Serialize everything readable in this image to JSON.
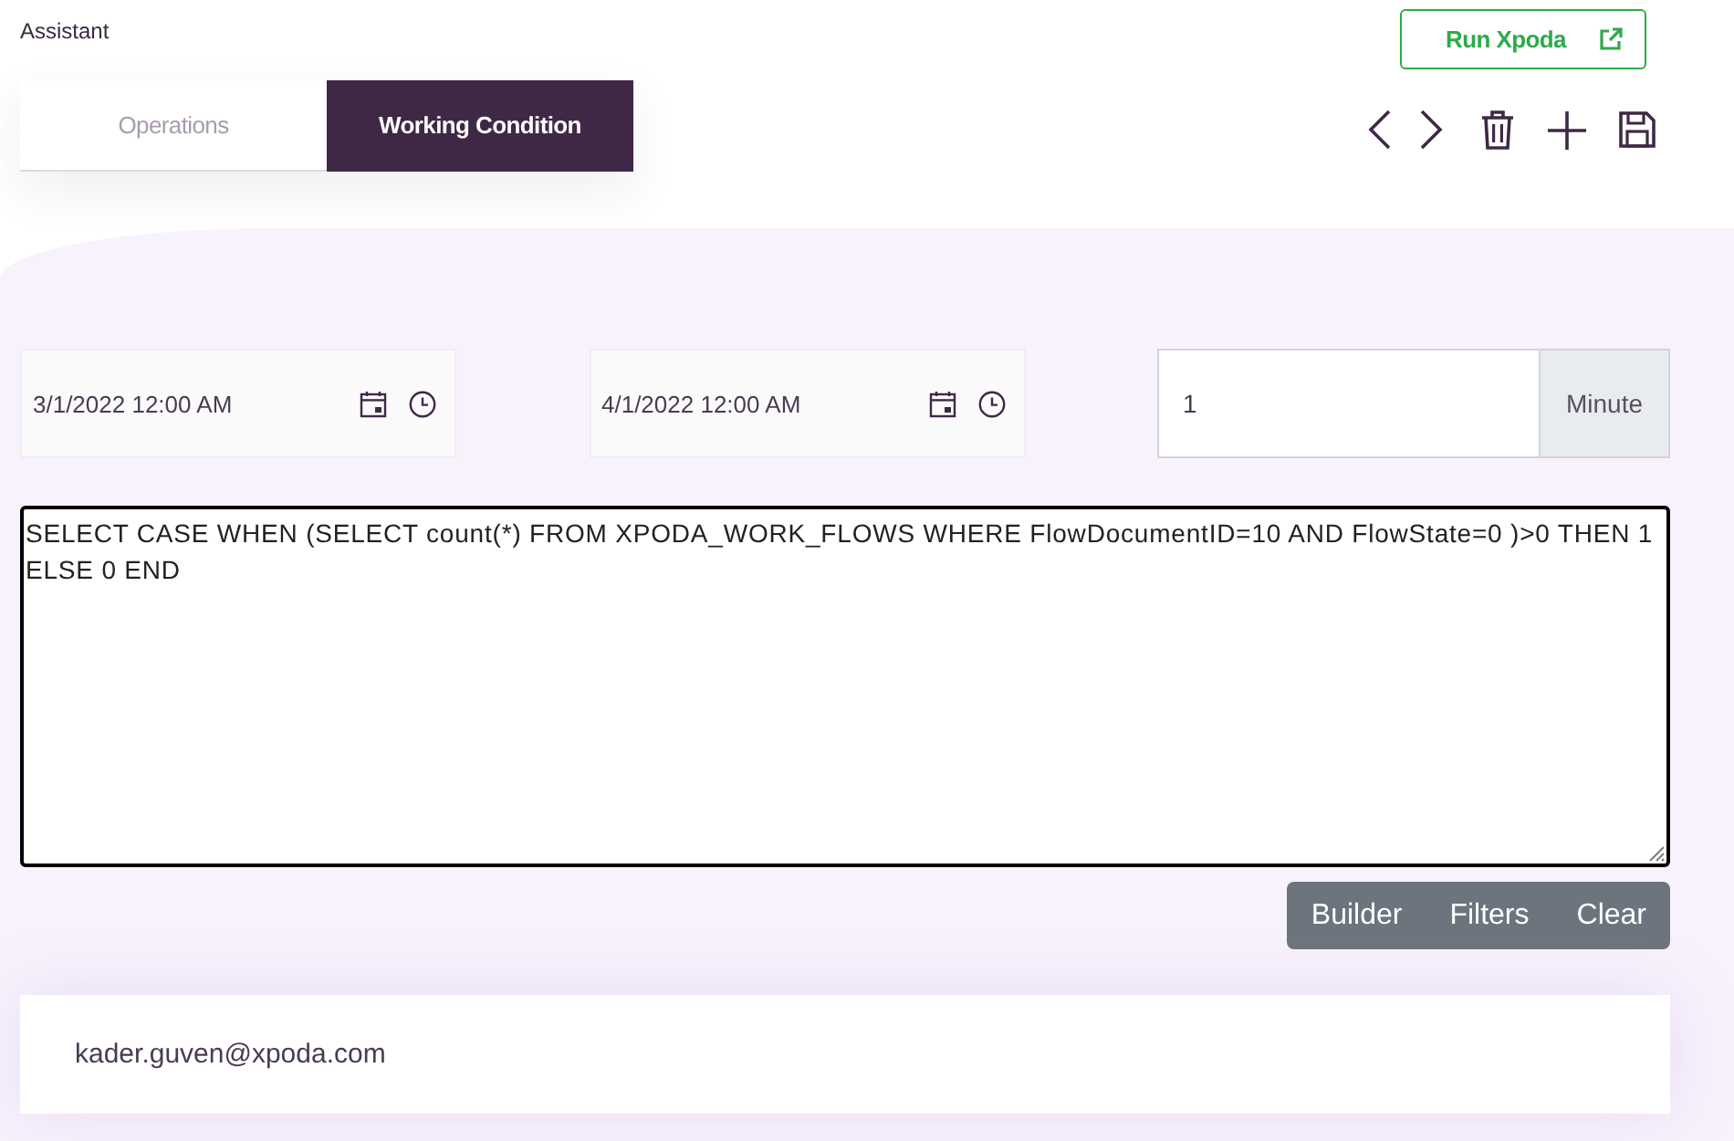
{
  "header": {
    "title": "Assistant"
  },
  "tabs": [
    {
      "label": "Operations",
      "selected": false
    },
    {
      "label": "Working Condition",
      "selected": true
    }
  ],
  "run_button": {
    "label": "Run Xpoda"
  },
  "date_range": [
    {
      "value": "3/1/2022 12:00 AM"
    },
    {
      "value": "4/1/2022 12:00 AM"
    }
  ],
  "interval": {
    "value": "1",
    "unit": "Minute"
  },
  "query": {
    "value": "SELECT CASE WHEN (SELECT count(*) FROM XPODA_WORK_FLOWS WHERE FlowDocumentID=10 AND FlowState=0 )>0 THEN 1 ELSE 0 END"
  },
  "query_buttons": [
    "Builder",
    "Filters",
    "Clear"
  ],
  "user": {
    "email": "kader.guven@xpoda.com"
  }
}
